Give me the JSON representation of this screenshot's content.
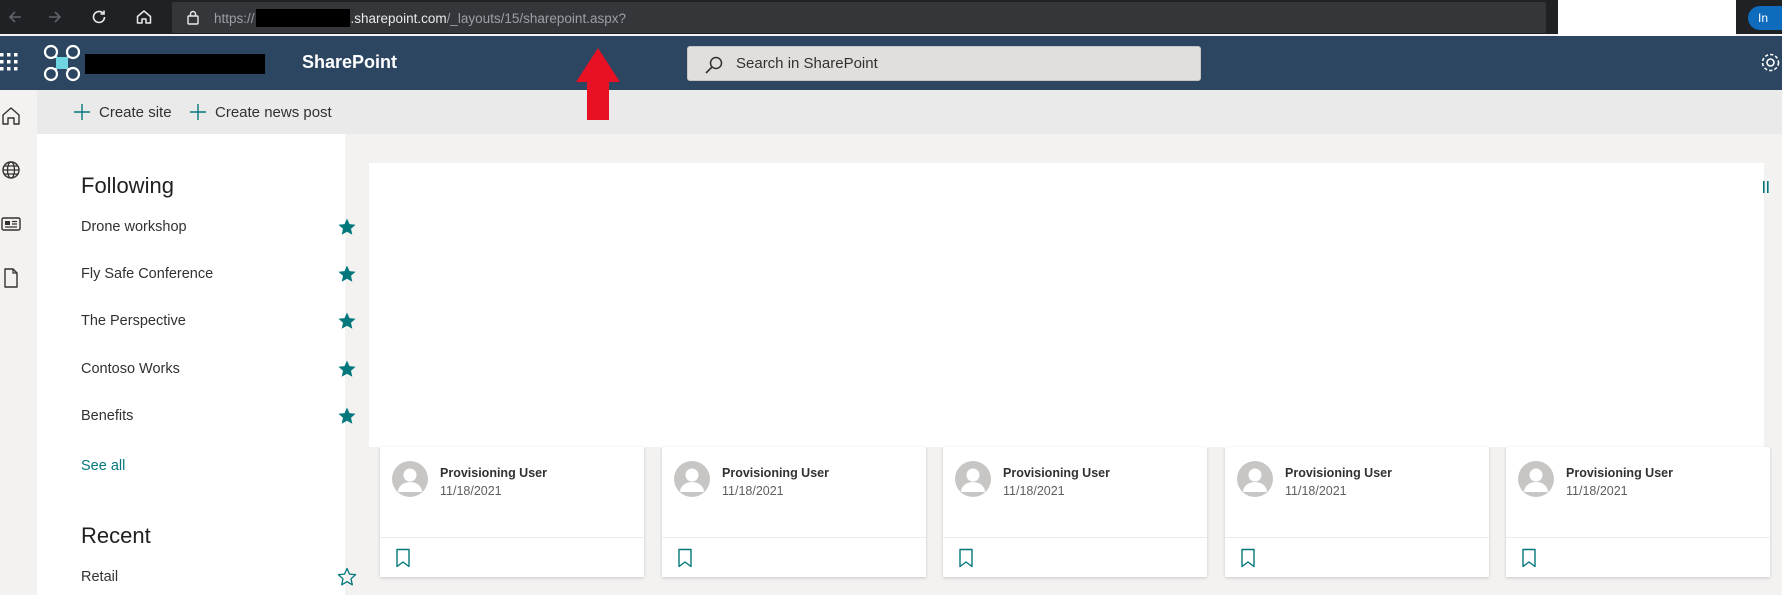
{
  "browser": {
    "url_proto": "https://",
    "url_domain": ".sharepoint.com",
    "url_path": "/_layouts/15/sharepoint.aspx?",
    "profile_button": "In"
  },
  "suite": {
    "brand": "SharePoint",
    "search_placeholder": "Search in SharePoint"
  },
  "command_bar": {
    "create_site": "Create site",
    "create_news": "Create news post"
  },
  "following": {
    "heading": "Following",
    "items": [
      {
        "label": "Drone workshop",
        "starred": true
      },
      {
        "label": "Fly Safe Conference",
        "starred": true
      },
      {
        "label": "The Perspective",
        "starred": true
      },
      {
        "label": "Contoso Works",
        "starred": true
      },
      {
        "label": "Benefits",
        "starred": true
      }
    ],
    "see_all": "See all"
  },
  "recent": {
    "heading": "Recent",
    "items": [
      {
        "label": "Retail",
        "starred": false
      }
    ]
  },
  "news_cards": [
    {
      "author": "Provisioning User",
      "date": "11/18/2021"
    },
    {
      "author": "Provisioning User",
      "date": "11/18/2021"
    },
    {
      "author": "Provisioning User",
      "date": "11/18/2021"
    },
    {
      "author": "Provisioning User",
      "date": "11/18/2021"
    },
    {
      "author": "Provisioning User",
      "date": "11/18/2021"
    }
  ],
  "colors": {
    "suite_bar": "#2c4661",
    "accent_teal": "#03787c",
    "annotation_arrow": "#e81123"
  },
  "icons": [
    "back-icon",
    "forward-icon",
    "refresh-icon",
    "home-icon",
    "lock-icon",
    "favorite-icon",
    "waffle-icon",
    "drone-logo-icon",
    "search-icon",
    "settings-icon",
    "globe-icon",
    "news-icon",
    "file-icon",
    "plus-icon",
    "star-icon",
    "avatar-icon",
    "bookmark-icon",
    "red-arrow-icon"
  ]
}
